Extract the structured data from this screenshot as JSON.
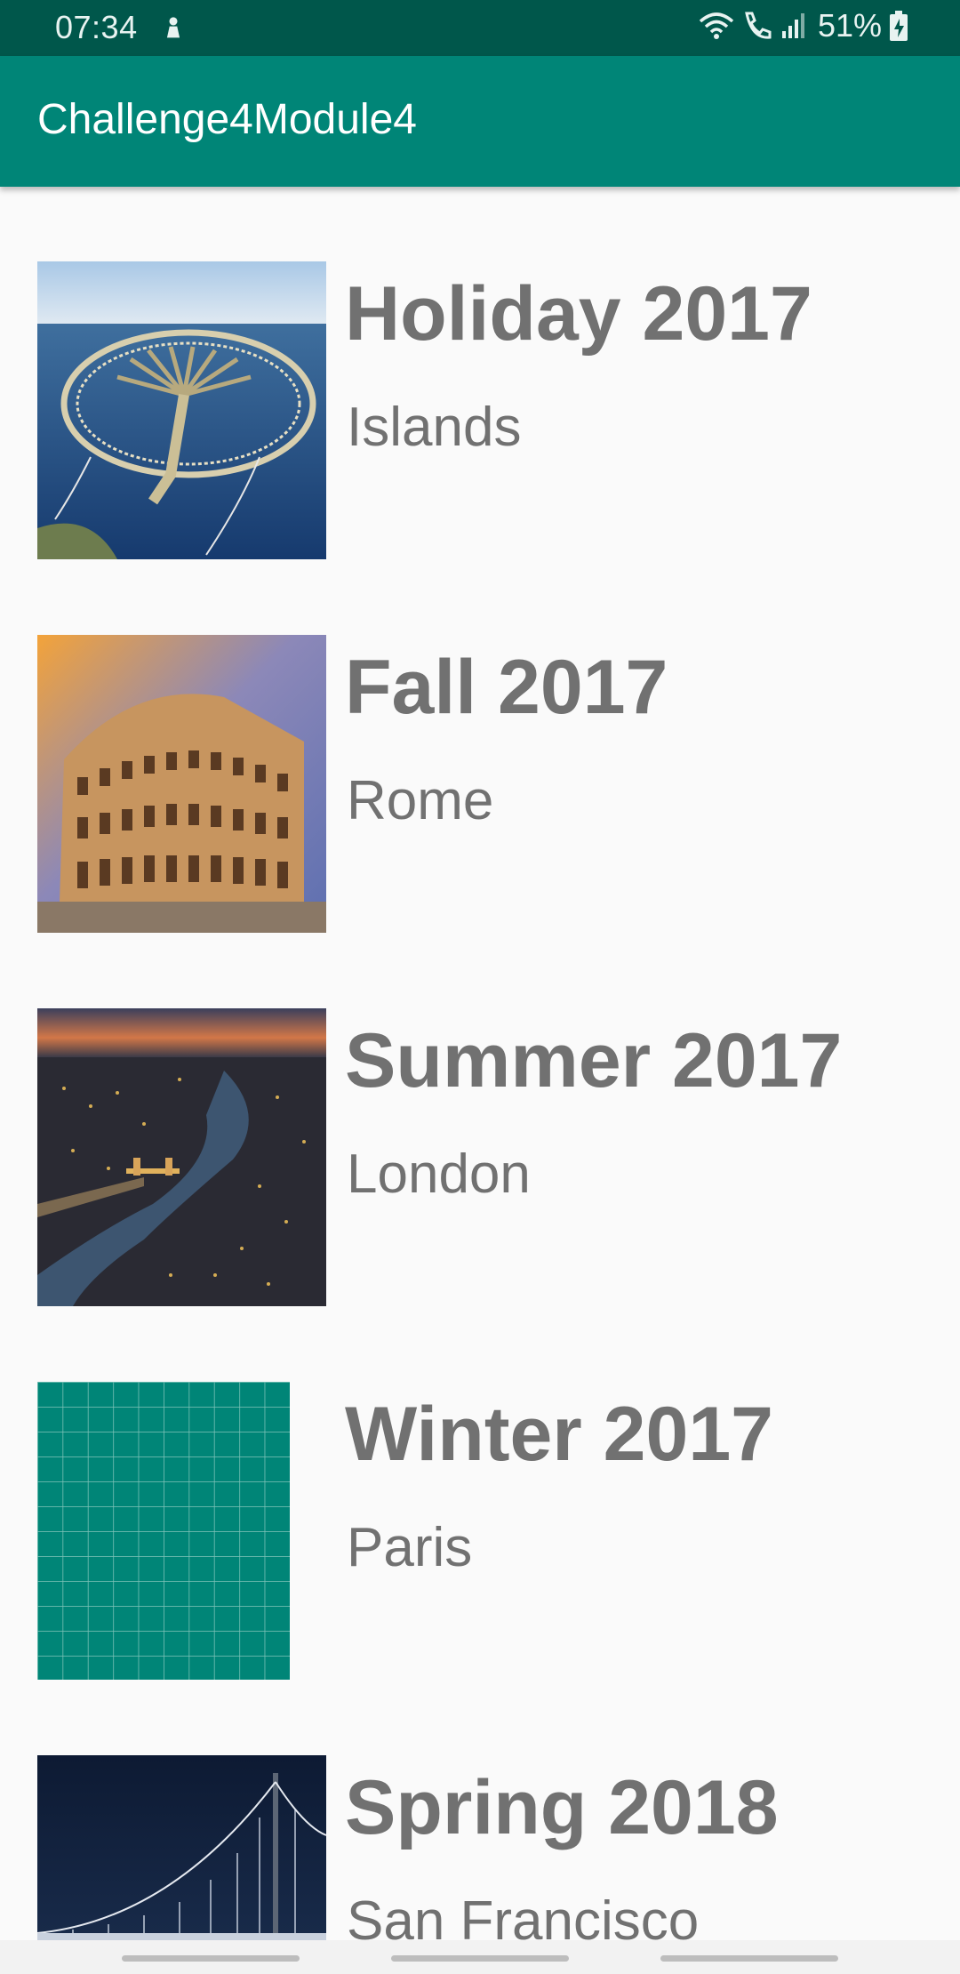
{
  "status_bar": {
    "time": "07:34",
    "notification_icon": "download-icon",
    "wifi_icon": "wifi-icon",
    "call_icon": "wifi-call-icon",
    "signal_icon": "signal-icon",
    "battery_percent": "51%",
    "battery_icon": "battery-charging-icon",
    "background": "#00574b"
  },
  "app_bar": {
    "title": "Challenge4Module4",
    "background": "#008577"
  },
  "items": [
    {
      "title": "Holiday 2017",
      "subtitle": "Islands",
      "image": "palm-islands-photo"
    },
    {
      "title": "Fall 2017",
      "subtitle": "Rome",
      "image": "colosseum-photo"
    },
    {
      "title": "Summer 2017",
      "subtitle": "London",
      "image": "london-night-photo"
    },
    {
      "title": "Winter 2017",
      "subtitle": "Paris",
      "image": "placeholder-grid"
    },
    {
      "title": "Spring 2018",
      "subtitle": "San Francisco",
      "image": "bay-bridge-photo"
    }
  ]
}
